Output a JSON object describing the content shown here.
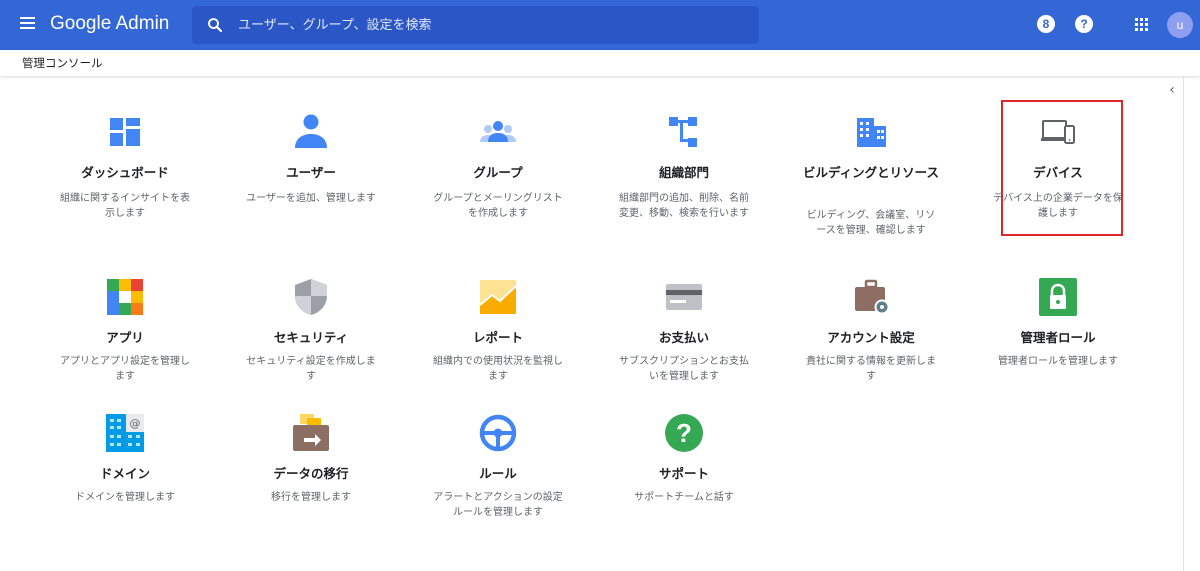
{
  "header": {
    "brand": "Google Admin",
    "search_placeholder": "ユーザー、グループ、設定を検索",
    "badge_icon_text": "8",
    "help_icon_text": "?",
    "avatar_letter": "u"
  },
  "breadcrumb": "管理コンソール",
  "tiles": [
    {
      "title": "ダッシュボード",
      "desc": "組織に関するインサイトを表示します",
      "icon": "dashboard-icon"
    },
    {
      "title": "ユーザー",
      "desc": "ユーザーを追加、管理します",
      "icon": "user-icon"
    },
    {
      "title": "グループ",
      "desc": "グループとメーリングリストを作成します",
      "icon": "group-icon"
    },
    {
      "title": "組織部門",
      "desc": "組織部門の追加、削除、名前変更、移動、検索を行います",
      "icon": "org-unit-icon"
    },
    {
      "title": "ビルディングとリソース",
      "desc": "ビルディング、会議室、リソースを管理、確認します",
      "icon": "building-icon"
    },
    {
      "title": "デバイス",
      "desc": "デバイス上の企業データを保護します",
      "icon": "devices-icon"
    },
    {
      "title": "アプリ",
      "desc": "アプリとアプリ設定を管理します",
      "icon": "apps-tile-icon"
    },
    {
      "title": "セキュリティ",
      "desc": "セキュリティ設定を作成します",
      "icon": "shield-icon"
    },
    {
      "title": "レポート",
      "desc": "組織内での使用状況を監視します",
      "icon": "reports-chart-icon"
    },
    {
      "title": "お支払い",
      "desc": "サブスクリプションとお支払いを管理します",
      "icon": "credit-card-icon"
    },
    {
      "title": "アカウント設定",
      "desc": "貴社に関する情報を更新します",
      "icon": "briefcase-gear-icon"
    },
    {
      "title": "管理者ロール",
      "desc": "管理者ロールを管理します",
      "icon": "lock-icon"
    },
    {
      "title": "ドメイン",
      "desc": "ドメインを管理します",
      "icon": "domain-icon"
    },
    {
      "title": "データの移行",
      "desc": "移行を管理します",
      "icon": "data-migration-icon"
    },
    {
      "title": "ルール",
      "desc": "アラートとアクションの設定ルールを管理します",
      "icon": "steering-wheel-icon"
    },
    {
      "title": "サポート",
      "desc": "サポートチームと話す",
      "icon": "help-circle-icon"
    }
  ]
}
